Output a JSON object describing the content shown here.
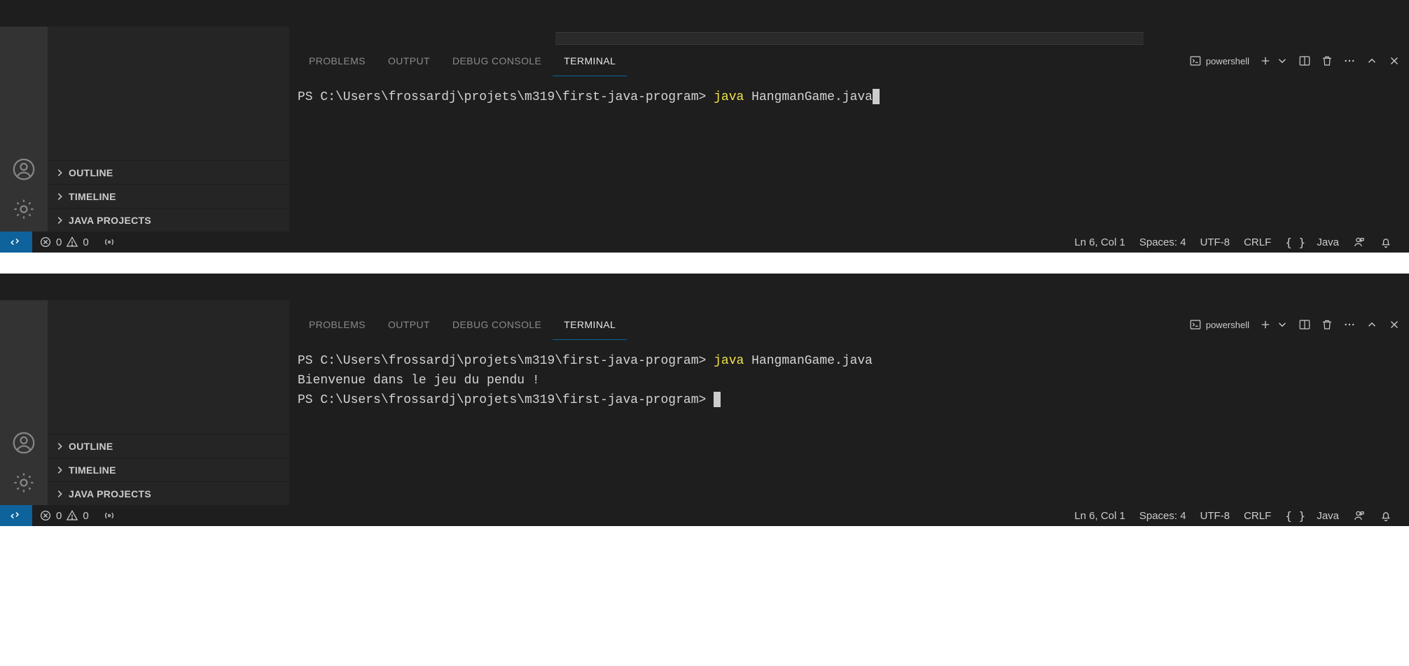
{
  "sidebar": {
    "sections": [
      "OUTLINE",
      "TIMELINE",
      "JAVA PROJECTS"
    ]
  },
  "panel": {
    "tabs": {
      "problems": "PROBLEMS",
      "output": "OUTPUT",
      "debug": "DEBUG CONSOLE",
      "terminal": "TERMINAL"
    },
    "shell_label": "powershell"
  },
  "terminal1": {
    "prompt": "PS C:\\Users\\frossardj\\projets\\m319\\first-java-program>",
    "cmd": "java",
    "arg": "HangmanGame.java"
  },
  "terminal2": {
    "prompt1": "PS C:\\Users\\frossardj\\projets\\m319\\first-java-program>",
    "cmd": "java",
    "arg": "HangmanGame.java",
    "output_line": "Bienvenue dans le jeu du pendu !",
    "prompt2": "PS C:\\Users\\frossardj\\projets\\m319\\first-java-program>"
  },
  "status": {
    "errors": "0",
    "warnings": "0",
    "ln_col": "Ln 6, Col 1",
    "spaces": "Spaces: 4",
    "encoding": "UTF-8",
    "eol": "CRLF",
    "braces": "{ }",
    "lang": "Java"
  }
}
